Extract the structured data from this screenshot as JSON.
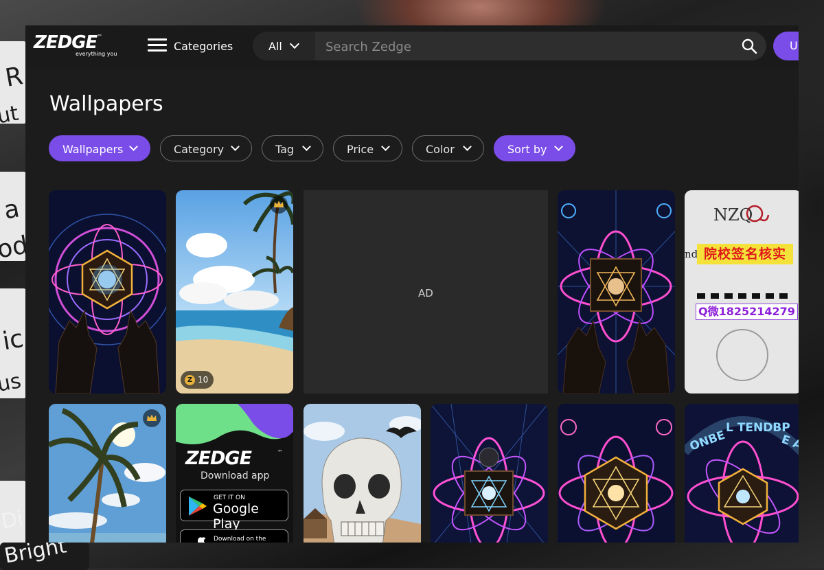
{
  "brand": {
    "logo": "ZEDGE",
    "tm": "™",
    "tagline": "everything you"
  },
  "nav": {
    "categories_label": "Categories"
  },
  "search": {
    "scope": "All",
    "placeholder": "Search Zedge"
  },
  "upload": {
    "label": "Up"
  },
  "page": {
    "title": "Wallpapers"
  },
  "filters": [
    {
      "label": "Wallpapers",
      "active": true
    },
    {
      "label": "Category",
      "active": false
    },
    {
      "label": "Tag",
      "active": false
    },
    {
      "label": "Price",
      "active": false
    },
    {
      "label": "Color",
      "active": false
    },
    {
      "label": "Sort by",
      "active": true
    }
  ],
  "grid": {
    "ad_label": "AD",
    "coin_price": "10",
    "coin_symbol": "Z",
    "cert": {
      "title": "NZQ",
      "and": "nd",
      "red_text": "院校签名核实",
      "qq_text": "Q微1825214279"
    },
    "app_card": {
      "logo": "ZEDGE",
      "tm": "™",
      "subtitle": "Download app",
      "play_small": "GET IT ON",
      "play_big": "Google Play",
      "apple_small": "Download on the"
    }
  },
  "background_text": [
    "R",
    "ut",
    "a",
    "od",
    "ic",
    "us",
    "Di",
    "Bright"
  ],
  "colors": {
    "accent": "#7b4de8",
    "app_bg": "#1c1c1c",
    "topbar": "#1a1a1a",
    "search_bg": "#2e2e2e"
  }
}
